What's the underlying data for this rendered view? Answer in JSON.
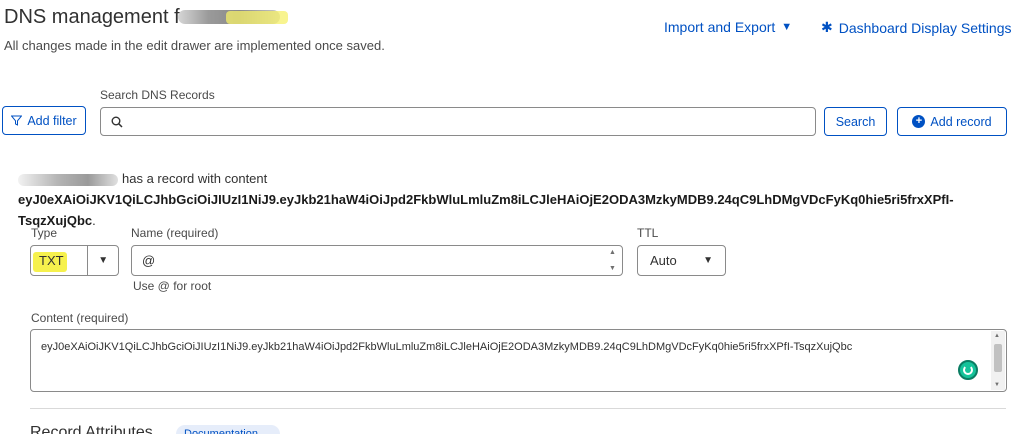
{
  "header": {
    "title": "DNS management for",
    "subtitle": "All changes made in the edit drawer are implemented once saved.",
    "import_export": "Import and Export",
    "dashboard_settings": "Dashboard Display Settings"
  },
  "toolbar": {
    "add_filter": "Add filter",
    "search_label": "Search DNS Records",
    "search_placeholder": "",
    "search_button": "Search",
    "add_record": "Add record"
  },
  "message": {
    "prefix": "has a record with content",
    "content": "eyJ0eXAiOiJKV1QiLCJhbGciOiJIUzI1NiJ9.eyJkb21haW4iOiJpd2FkbWluLmluZm8iLCJleHAiOjE2ODA3MzkyMDB9.24qC9LhDMgVDcFyKq0hie5ri5frxXPfI-TsqzXujQbc",
    "suffix": "."
  },
  "form": {
    "type_label": "Type",
    "type_value": "TXT",
    "name_label": "Name (required)",
    "name_value": "@",
    "name_hint": "Use @ for root",
    "ttl_label": "TTL",
    "ttl_value": "Auto",
    "content_label": "Content (required)",
    "content_value": "eyJ0eXAiOiJKV1QiLCJhbGciOiJIUzI1NiJ9.eyJkb21haW4iOiJpd2FkbWluLmluZm8iLCJleHAiOjE2ODA3MzkyMDB9.24qC9LhDMgVDcFyKq0hie5ri5frxXPfI-TsqzXujQbc"
  },
  "footer": {
    "section_heading": "Record Attributes",
    "doc_pill": "Documentation"
  },
  "colors": {
    "accent": "#0051c3",
    "highlight": "#f5ee2e"
  }
}
